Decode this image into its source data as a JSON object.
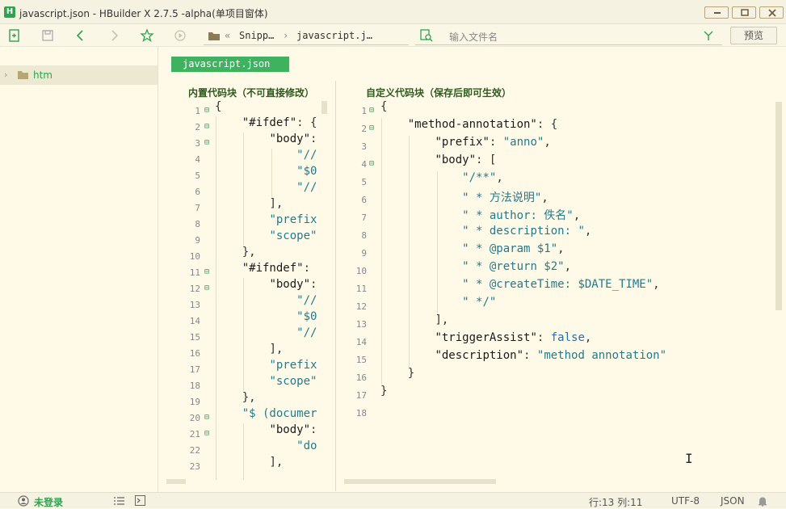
{
  "window": {
    "title": "javascript.json - HBuilder X 2.7.5 -alpha(单项目窗体)",
    "logo_letter": "H"
  },
  "toolbar": {
    "breadcrumb_sep": "«",
    "breadcrumb_1": "Snipp…",
    "breadcrumb_arrow": "›",
    "breadcrumb_2": "javascript.j…",
    "search_placeholder": "输入文件名",
    "preview_label": "预览"
  },
  "sidebar": {
    "items": [
      {
        "label": "htm"
      }
    ]
  },
  "editor": {
    "tab_label": "javascript.json",
    "left_pane_title": "内置代码块（不可直接修改）",
    "right_pane_title": "自定义代码块（保存后即可生效）",
    "left_lines": [
      {
        "n": "1",
        "fold": "⊟",
        "text": "{"
      },
      {
        "n": "2",
        "fold": "⊟",
        "text": "    \"#ifdef\": {"
      },
      {
        "n": "3",
        "fold": "⊟",
        "text": "        \"body\": ["
      },
      {
        "n": "4",
        "fold": "",
        "text": "            \"//"
      },
      {
        "n": "5",
        "fold": "",
        "text": "            \"$0"
      },
      {
        "n": "6",
        "fold": "",
        "text": "            \"//"
      },
      {
        "n": "7",
        "fold": "",
        "text": "        ],"
      },
      {
        "n": "8",
        "fold": "",
        "text": "        \"prefix"
      },
      {
        "n": "9",
        "fold": "",
        "text": "        \"scope\""
      },
      {
        "n": "10",
        "fold": "",
        "text": "    },"
      },
      {
        "n": "11",
        "fold": "⊟",
        "text": "    \"#ifndef\":"
      },
      {
        "n": "12",
        "fold": "⊟",
        "text": "        \"body\":"
      },
      {
        "n": "13",
        "fold": "",
        "text": "            \"//"
      },
      {
        "n": "14",
        "fold": "",
        "text": "            \"$0"
      },
      {
        "n": "15",
        "fold": "",
        "text": "            \"//"
      },
      {
        "n": "16",
        "fold": "",
        "text": "        ],"
      },
      {
        "n": "17",
        "fold": "",
        "text": "        \"prefix"
      },
      {
        "n": "18",
        "fold": "",
        "text": "        \"scope\""
      },
      {
        "n": "19",
        "fold": "",
        "text": "    },"
      },
      {
        "n": "20",
        "fold": "⊟",
        "text": "    \"$ (documer"
      },
      {
        "n": "21",
        "fold": "⊟",
        "text": "        \"body\":"
      },
      {
        "n": "22",
        "fold": "",
        "text": "            \"do"
      },
      {
        "n": "23",
        "fold": "",
        "text": "        ],"
      }
    ],
    "right_lines": [
      {
        "n": "1",
        "fold": "⊟",
        "text": "{"
      },
      {
        "n": "2",
        "fold": "⊟",
        "text": "    \"method-annotation\": {"
      },
      {
        "n": "3",
        "fold": "",
        "text": "        \"prefix\": \"anno\","
      },
      {
        "n": "4",
        "fold": "⊟",
        "text": "        \"body\": ["
      },
      {
        "n": "5",
        "fold": "",
        "text": "            \"/**\","
      },
      {
        "n": "6",
        "fold": "",
        "text": "            \" * 方法说明\","
      },
      {
        "n": "7",
        "fold": "",
        "text": "            \" * author: 佚名\","
      },
      {
        "n": "8",
        "fold": "",
        "text": "            \" * description: \","
      },
      {
        "n": "9",
        "fold": "",
        "text": "            \" * @param $1\","
      },
      {
        "n": "10",
        "fold": "",
        "text": "            \" * @return $2\","
      },
      {
        "n": "11",
        "fold": "",
        "text": "            \" * @createTime: $DATE_TIME\","
      },
      {
        "n": "12",
        "fold": "",
        "text": "            \" */\""
      },
      {
        "n": "13",
        "fold": "",
        "text": "        ],"
      },
      {
        "n": "14",
        "fold": "",
        "text": "        \"triggerAssist\": false,"
      },
      {
        "n": "15",
        "fold": "",
        "text": "        \"description\": \"method annotation\""
      },
      {
        "n": "16",
        "fold": "",
        "text": "    }"
      },
      {
        "n": "17",
        "fold": "",
        "text": "}"
      },
      {
        "n": "18",
        "fold": "",
        "text": ""
      }
    ]
  },
  "statusbar": {
    "login_label": "未登录",
    "line_col": "行:13  列:11",
    "encoding": "UTF-8",
    "language": "JSON"
  },
  "colors": {
    "accent": "#3fb25f",
    "background": "#fffae8",
    "string": "#237a8c",
    "boolean": "#1e6fb8"
  }
}
